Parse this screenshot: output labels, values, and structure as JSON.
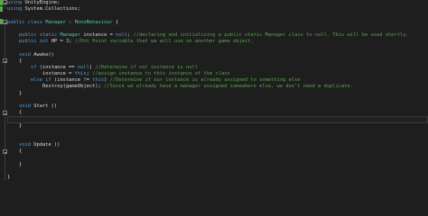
{
  "editor": {
    "lines": [
      {
        "indent": "",
        "tokens": [
          {
            "t": "using",
            "c": "kw"
          },
          {
            "t": " UnityEngine;",
            "c": ""
          }
        ]
      },
      {
        "indent": "",
        "tokens": [
          {
            "t": "using",
            "c": "kw"
          },
          {
            "t": " System.Collections;",
            "c": ""
          }
        ]
      },
      {
        "indent": "",
        "tokens": []
      },
      {
        "indent": "",
        "tokens": [
          {
            "t": "public",
            "c": "kw"
          },
          {
            "t": " ",
            "c": ""
          },
          {
            "t": "class",
            "c": "kw"
          },
          {
            "t": " ",
            "c": ""
          },
          {
            "t": "Manager",
            "c": "type"
          },
          {
            "t": " : ",
            "c": ""
          },
          {
            "t": "MonoBehaviour",
            "c": "type"
          },
          {
            "t": " {",
            "c": ""
          }
        ]
      },
      {
        "indent": "",
        "tokens": []
      },
      {
        "indent": "    ",
        "tokens": [
          {
            "t": "public",
            "c": "kw"
          },
          {
            "t": " ",
            "c": ""
          },
          {
            "t": "static",
            "c": "kw"
          },
          {
            "t": " ",
            "c": ""
          },
          {
            "t": "Manager",
            "c": "type"
          },
          {
            "t": " instance = ",
            "c": ""
          },
          {
            "t": "null",
            "c": "kw"
          },
          {
            "t": "; ",
            "c": ""
          },
          {
            "t": "//declaring and initializing a public static Manager class to null. This will be used shortly.",
            "c": "cm"
          }
        ]
      },
      {
        "indent": "    ",
        "tokens": [
          {
            "t": "public",
            "c": "kw"
          },
          {
            "t": " ",
            "c": ""
          },
          {
            "t": "int",
            "c": "kw"
          },
          {
            "t": " HP = ",
            "c": ""
          },
          {
            "t": "3",
            "c": "num"
          },
          {
            "t": "; ",
            "c": ""
          },
          {
            "t": "//Hit Point variable that we will use on another game object.",
            "c": "cm"
          }
        ]
      },
      {
        "indent": "",
        "tokens": []
      },
      {
        "indent": "    ",
        "tokens": [
          {
            "t": "void",
            "c": "kw"
          },
          {
            "t": " Awake()",
            "c": ""
          }
        ]
      },
      {
        "indent": "    ",
        "tokens": [
          {
            "t": "{",
            "c": ""
          }
        ]
      },
      {
        "indent": "        ",
        "tokens": [
          {
            "t": "if",
            "c": "kw"
          },
          {
            "t": " (instance == ",
            "c": ""
          },
          {
            "t": "null",
            "c": "kw"
          },
          {
            "t": ") ",
            "c": ""
          },
          {
            "t": "//Determine if our instance is null",
            "c": "cm"
          }
        ]
      },
      {
        "indent": "            ",
        "tokens": [
          {
            "t": "instance = ",
            "c": ""
          },
          {
            "t": "this",
            "c": "kw"
          },
          {
            "t": "; ",
            "c": ""
          },
          {
            "t": "//assign instance to this instance of the class",
            "c": "cm"
          }
        ]
      },
      {
        "indent": "        ",
        "tokens": [
          {
            "t": "else",
            "c": "kw"
          },
          {
            "t": " ",
            "c": ""
          },
          {
            "t": "if",
            "c": "kw"
          },
          {
            "t": " (instance != ",
            "c": ""
          },
          {
            "t": "this",
            "c": "kw"
          },
          {
            "t": ") ",
            "c": ""
          },
          {
            "t": "//Determine if our instance is already assigned to something else",
            "c": "cm"
          }
        ]
      },
      {
        "indent": "            ",
        "tokens": [
          {
            "t": "Destroy(gameObject); ",
            "c": ""
          },
          {
            "t": "//Since we already have a manager assigned somewhere else, we don't need a duplicate.",
            "c": "cm"
          }
        ]
      },
      {
        "indent": "    ",
        "tokens": [
          {
            "t": "}",
            "c": ""
          }
        ]
      },
      {
        "indent": "",
        "tokens": []
      },
      {
        "indent": "    ",
        "tokens": [
          {
            "t": "void",
            "c": "kw"
          },
          {
            "t": " Start ()",
            "c": ""
          }
        ]
      },
      {
        "indent": "    ",
        "tokens": [
          {
            "t": "{",
            "c": ""
          }
        ]
      },
      {
        "indent": "",
        "tokens": [],
        "current": true
      },
      {
        "indent": "    ",
        "tokens": [
          {
            "t": "}",
            "c": ""
          }
        ]
      },
      {
        "indent": "",
        "tokens": []
      },
      {
        "indent": "",
        "tokens": []
      },
      {
        "indent": "    ",
        "tokens": [
          {
            "t": "void",
            "c": "kw"
          },
          {
            "t": " Update ()",
            "c": ""
          }
        ]
      },
      {
        "indent": "    ",
        "tokens": [
          {
            "t": "{",
            "c": ""
          }
        ]
      },
      {
        "indent": "",
        "tokens": []
      },
      {
        "indent": "    ",
        "tokens": [
          {
            "t": "}",
            "c": ""
          }
        ]
      },
      {
        "indent": "",
        "tokens": []
      },
      {
        "indent": "",
        "tokens": [
          {
            "t": "}",
            "c": ""
          }
        ]
      }
    ],
    "colors": {
      "background": "#1e1e1e",
      "keyword": "#569cd6",
      "type": "#4ec9b0",
      "comment": "#57a64a",
      "text": "#dcdcdc",
      "number": "#b5cea8"
    }
  }
}
